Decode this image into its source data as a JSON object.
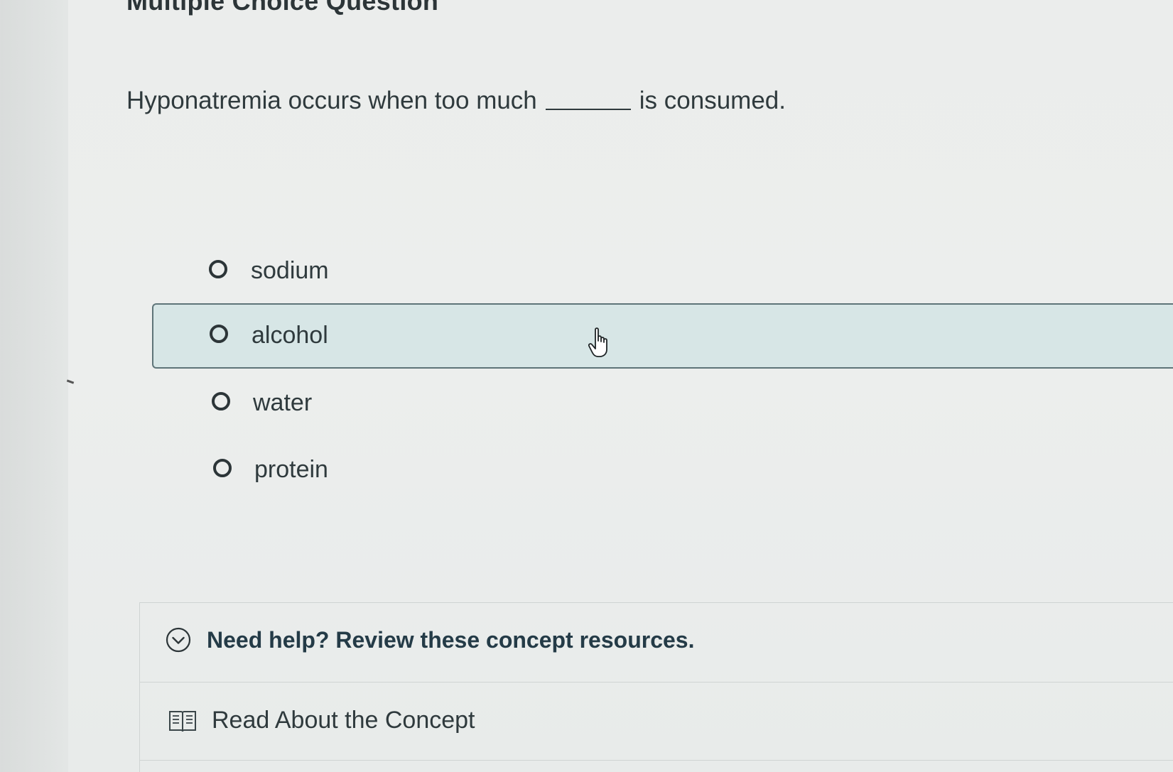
{
  "header": {
    "title": "Multiple Choice Question"
  },
  "question": {
    "stem_before": "Hyponatremia occurs when too much",
    "stem_after": "is consumed."
  },
  "options": [
    {
      "label": "sodium",
      "highlighted": false
    },
    {
      "label": "alcohol",
      "highlighted": true
    },
    {
      "label": "water",
      "highlighted": false
    },
    {
      "label": "protein",
      "highlighted": false
    }
  ],
  "help": {
    "title": "Need help? Review these concept resources.",
    "icon": "chevron-down-circle-icon",
    "resources": [
      {
        "label": "Read About the Concept",
        "icon": "book-icon"
      }
    ]
  },
  "colors": {
    "highlight_bg": "#d7e6e6",
    "highlight_border": "#5e7478",
    "help_title": "#243b47",
    "text": "#2f3a3d"
  }
}
